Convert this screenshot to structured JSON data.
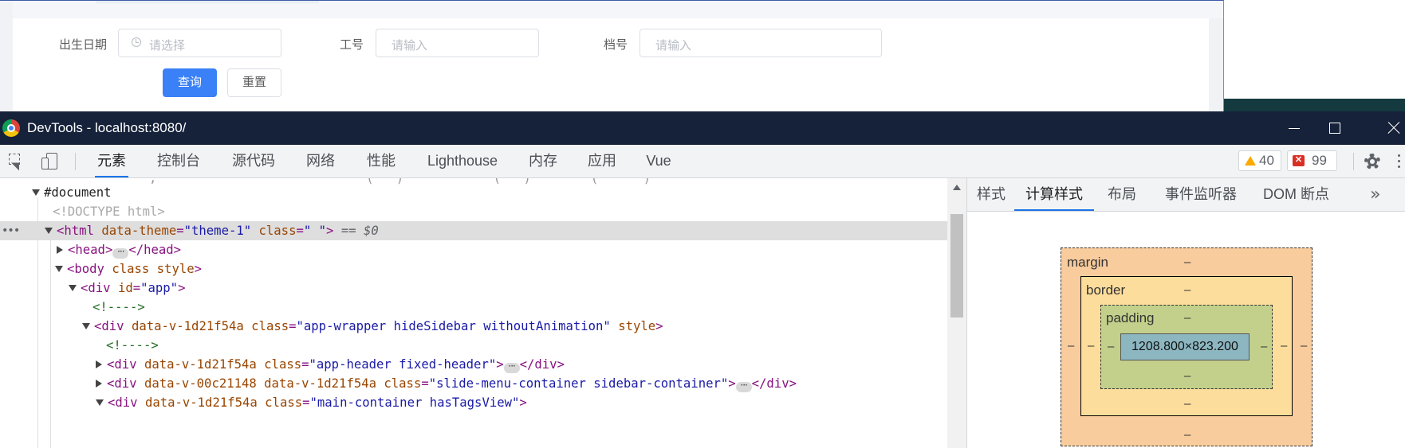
{
  "page": {
    "form": {
      "birth_label": "出生日期",
      "birth_placeholder": "请选择",
      "empno_label": "工号",
      "empno_placeholder": "请输入",
      "fileno_label": "档号",
      "fileno_placeholder": "请输入",
      "query_label": "查询",
      "reset_label": "重置"
    }
  },
  "devtools": {
    "title": "DevTools - localhost:8080/",
    "tabs": [
      "元素",
      "控制台",
      "源代码",
      "网络",
      "性能",
      "Lighthouse",
      "内存",
      "应用",
      "Vue"
    ],
    "active_tab": "元素",
    "warnings": "40",
    "errors": "99",
    "side_tabs": [
      "样式",
      "计算样式",
      "布局",
      "事件监听器",
      "DOM 断点"
    ],
    "active_side_tab": "计算样式",
    "more_tabs": "»",
    "box_model": {
      "margin_label": "margin",
      "border_label": "border",
      "padding_label": "padding",
      "content_size": "1208.800×823.200",
      "dash": "–"
    },
    "selected_suffix": "== $0",
    "tree": {
      "document": "#document",
      "doctype": "<!DOCTYPE html>",
      "html_tag_open": "<html",
      "html_attr1": "data-theme",
      "html_val1": "\"theme-1\"",
      "html_attr2": "class",
      "html_val2": "\" \"",
      "head_open": "<head>",
      "head_close": "</head>",
      "body_open": "<body",
      "body_attrs": "class style",
      "div_app_open": "<div",
      "div_app_attr": "id",
      "div_app_val": "\"app\"",
      "comment": "<!---->",
      "wrapper_attr1": "data-v-1d21f54a",
      "wrapper_attr2": "class",
      "wrapper_val": "\"app-wrapper hideSidebar withoutAnimation\"",
      "wrapper_attr3": "style",
      "header_attr1": "data-v-1d21f54a",
      "header_val": "\"app-header fixed-header\"",
      "slide_attr1": "data-v-00c21148",
      "slide_attr2": "data-v-1d21f54a",
      "slide_val": "\"slide-menu-container sidebar-container\"",
      "main_attr1": "data-v-1d21f54a",
      "main_val": "\"main-container hasTagsView\"",
      "div_close": "</div>"
    }
  }
}
